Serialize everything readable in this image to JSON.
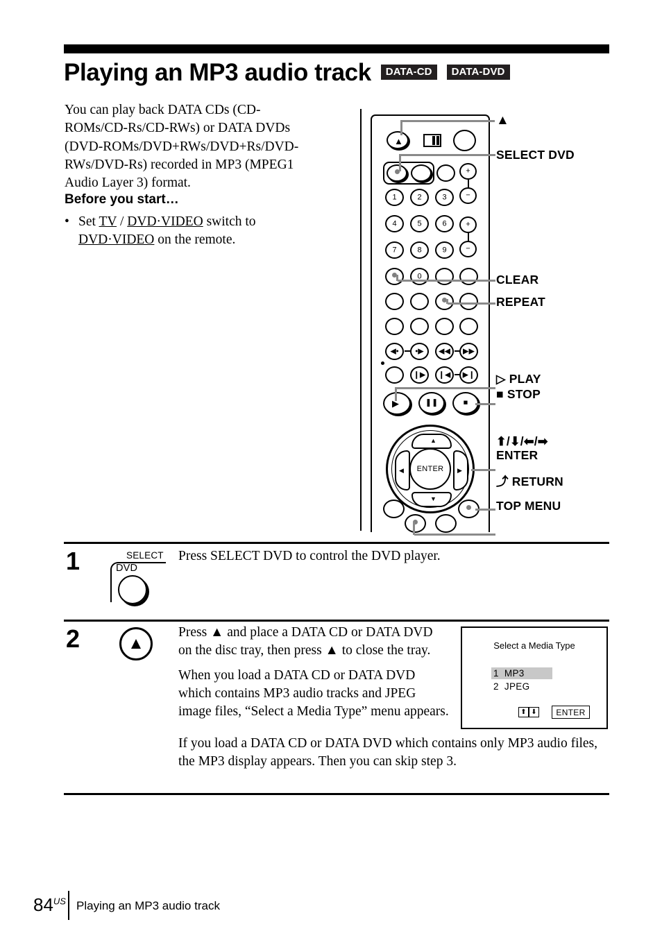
{
  "header": {
    "title": "Playing an MP3 audio track",
    "badges": [
      "DATA-CD",
      "DATA-DVD"
    ]
  },
  "intro": {
    "paragraph": "You can play back DATA CDs (CD-ROMs/CD-Rs/CD-RWs) or DATA DVDs (DVD-ROMs/DVD+RWs/DVD+Rs/DVD-RWs/DVD-Rs) recorded in MP3 (MPEG1 Audio Layer 3) format.",
    "before_you_start_heading": "Before you start…",
    "bullet_marker": "•",
    "bullet_prefix": "Set ",
    "bullet_switch_a": "TV",
    "bullet_sep": " / ",
    "bullet_switch_b": "DVD·VIDEO",
    "bullet_mid": " switch to ",
    "bullet_switch_c": "DVD·VIDEO",
    "bullet_suffix": " on the remote."
  },
  "remote": {
    "labels": {
      "eject": "▲",
      "select_dvd": "SELECT DVD",
      "clear": "CLEAR",
      "repeat": "REPEAT",
      "play": "▷  PLAY",
      "stop": "■ STOP",
      "arrows": "⬆/⬇/⬅/➡",
      "enter": "ENTER",
      "return": "RETURN",
      "return_icon": "⤴",
      "top_menu": "TOP MENU"
    },
    "keypad_digits": [
      "1",
      "2",
      "3",
      "4",
      "5",
      "6",
      "7",
      "8",
      "9",
      "0"
    ],
    "volume_plus": "+",
    "volume_minus": "−",
    "dpad_center": "ENTER"
  },
  "steps": [
    {
      "number": "1",
      "icon": {
        "select_word": "SELECT",
        "dvd_word": "DVD"
      },
      "paragraphs": [
        "Press SELECT DVD to control the DVD player."
      ]
    },
    {
      "number": "2",
      "icon": {
        "eject": "▲"
      },
      "paragraphs": [
        "Press ▲ and place a DATA CD or DATA DVD on the disc tray, then press ▲ to close the tray.",
        "When you load a DATA CD or DATA DVD which contains MP3 audio tracks and JPEG image files, “Select a Media Type” menu appears."
      ],
      "wide_paragraph": "If you load a DATA CD or DATA DVD which contains only MP3 audio files, the MP3 display appears. Then you can skip step 3."
    }
  ],
  "media_screen": {
    "title": "Select a Media Type",
    "options": [
      {
        "num": "1",
        "label": "MP3",
        "selected": true
      },
      {
        "num": "2",
        "label": "JPEG",
        "selected": false
      }
    ],
    "arrow_up": "⬆",
    "arrow_down": "⬇",
    "enter_label": "ENTER"
  },
  "footer": {
    "page_number": "84",
    "page_suffix": "US",
    "running_title": "Playing an MP3 audio track"
  }
}
